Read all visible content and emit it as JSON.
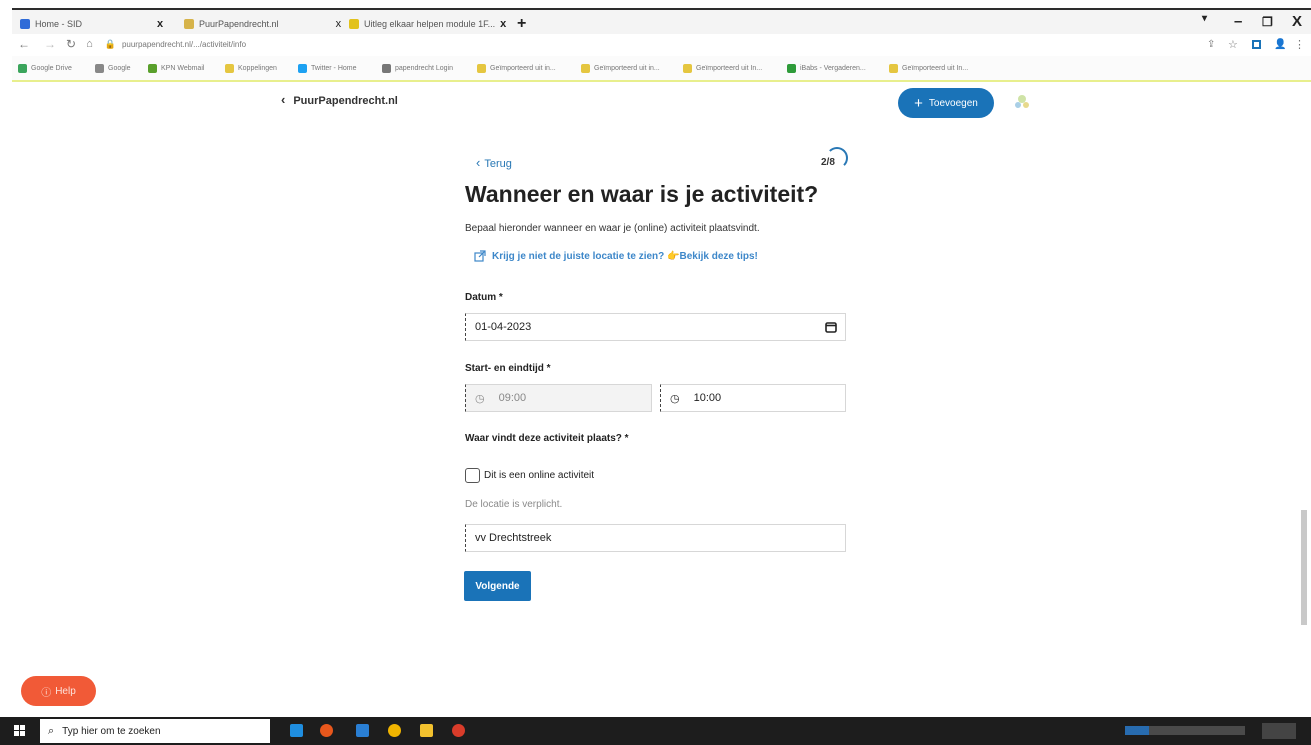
{
  "browser": {
    "tabs": [
      {
        "title": "Home - SID",
        "color": "#2f6bd8"
      },
      {
        "title": "PuurPapendrecht.nl",
        "color": "#d6b34a"
      },
      {
        "title": "Uitleg elkaar helpen module 1F...",
        "color": "#e2c21c"
      }
    ],
    "tab_close_glyph": "x",
    "new_tab_glyph": "+",
    "url": "puurpapendrecht.nl/.../activiteit/info",
    "window_controls": {
      "minimize": "–",
      "restore": "❐",
      "close": "X"
    },
    "bookmarks": [
      {
        "label": "Google Drive",
        "color": "#3ba55c"
      },
      {
        "label": "Google",
        "color": "#888888"
      },
      {
        "label": "KPN Webmail",
        "color": "#5aa02c"
      },
      {
        "label": "Koppelingen",
        "color": "#e5c640"
      },
      {
        "label": "Twitter - Home",
        "color": "#1da1f2"
      },
      {
        "label": "papendrecht Login",
        "color": "#777777"
      },
      {
        "label": "Geïmporteerd uit in...",
        "color": "#e5c640"
      },
      {
        "label": "Geïmporteerd uit in...",
        "color": "#e5c640"
      },
      {
        "label": "Geïmporteerd uit In...",
        "color": "#e5c640"
      },
      {
        "label": "iBabs - Vergaderen...",
        "color": "#2e9b3a"
      },
      {
        "label": "Geïmporteerd uit In...",
        "color": "#e5c640"
      }
    ]
  },
  "site": {
    "back_label": "PuurPapendrecht.nl",
    "add_button": "Toevoegen",
    "add_icon": "+"
  },
  "form": {
    "back": "Terug",
    "step": "2/8",
    "title": "Wanneer en waar is je activiteit?",
    "intro": "Bepaal hieronder wanneer en waar je (online) activiteit plaatsvindt.",
    "tips_link": "Krijg je niet de juiste locatie te zien? 👉Bekijk deze tips!",
    "date_label": "Datum *",
    "date_value": "01-04-2023",
    "time_label": "Start- en eindtijd *",
    "start_time": "09:00",
    "end_time": "10:00",
    "where_label": "Waar vindt deze activiteit plaats? *",
    "online_checkbox_label": "Dit is een online activiteit",
    "online_checked": false,
    "location_hint": "De locatie is verplicht.",
    "location_value": "vv Drechtstreek",
    "next_button": "Volgende"
  },
  "help_button": "Help",
  "taskbar": {
    "search_placeholder": "Typ hier om te zoeken",
    "apps": [
      {
        "name": "edge",
        "color": "#1f8ee0"
      },
      {
        "name": "firefox",
        "color": "#e8571c"
      },
      {
        "name": "store",
        "color": "#2a7fd4"
      },
      {
        "name": "chrome",
        "color": "#f0b400"
      },
      {
        "name": "explorer",
        "color": "#f2c12e"
      },
      {
        "name": "other",
        "color": "#d93c2a"
      }
    ]
  },
  "colors": {
    "primary": "#1a73b8",
    "link": "#3d87c9",
    "help": "#f15a37",
    "bookmark_divider": "#e8ef8d"
  }
}
